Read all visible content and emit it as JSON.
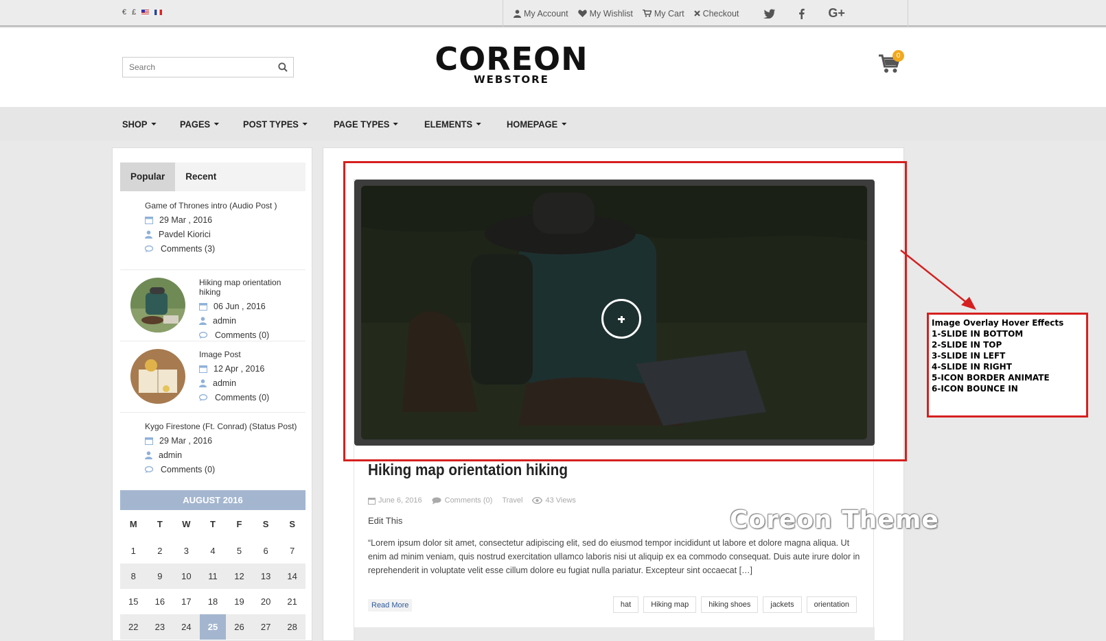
{
  "topbar": {
    "currencies": [
      "€",
      "£"
    ],
    "links": [
      {
        "label": "My Account",
        "icon": "user-icon"
      },
      {
        "label": "My Wishlist",
        "icon": "heart-icon"
      },
      {
        "label": "My Cart",
        "icon": "cart-icon"
      },
      {
        "label": "Checkout",
        "icon": "close-icon"
      }
    ],
    "social": [
      "twitter-icon",
      "facebook-icon",
      "google-plus-icon"
    ]
  },
  "header": {
    "search_placeholder": "Search",
    "logo_line1": "COREON",
    "logo_line2": "WEBSTORE",
    "cart_count": "0"
  },
  "nav": [
    "SHOP",
    "PAGES",
    "POST TYPES",
    "PAGE TYPES",
    "ELEMENTS",
    "HOMEPAGE"
  ],
  "sidebar": {
    "tabs": [
      "Popular",
      "Recent"
    ],
    "posts": [
      {
        "title": "Game of Thrones intro (Audio Post )",
        "date": "29 Mar , 2016",
        "author": "Pavdel Kiorici",
        "comments": "Comments (3)"
      },
      {
        "title": "Hiking map orientation hiking",
        "date": "06 Jun , 2016",
        "author": "admin",
        "comments": "Comments (0)"
      },
      {
        "title": "Image Post",
        "date": "12 Apr , 2016",
        "author": "admin",
        "comments": "Comments (0)"
      },
      {
        "title": "Kygo Firestone (Ft. Conrad) (Status Post)",
        "date": "29 Mar , 2016",
        "author": "admin",
        "comments": "Comments (0)"
      }
    ],
    "calendar": {
      "month": "AUGUST 2016",
      "days": [
        "M",
        "T",
        "W",
        "T",
        "F",
        "S",
        "S"
      ],
      "weeks": [
        [
          "1",
          "2",
          "3",
          "4",
          "5",
          "6",
          "7"
        ],
        [
          "8",
          "9",
          "10",
          "11",
          "12",
          "13",
          "14"
        ],
        [
          "15",
          "16",
          "17",
          "18",
          "19",
          "20",
          "21"
        ],
        [
          "22",
          "23",
          "24",
          "25",
          "26",
          "27",
          "28"
        ]
      ],
      "today": "25"
    }
  },
  "article": {
    "title": "Hiking map orientation hiking",
    "date": "June 6, 2016",
    "comments": "Comments (0)",
    "category": "Travel",
    "views": "43 Views",
    "edit": "Edit This",
    "excerpt": "“Lorem ipsum dolor sit amet, consectetur adipiscing elit, sed do eiusmod tempor incididunt ut labore et dolore magna aliqua. Ut enim ad minim veniam, quis nostrud exercitation ullamco laboris nisi ut aliquip ex ea commodo consequat. Duis aute irure dolor in reprehenderit in voluptate velit esse cillum dolore eu fugiat nulla pariatur. Excepteur sint occaecat […]",
    "read_more": "Read More",
    "tags": [
      "hat",
      "Hiking map",
      "hiking shoes",
      "jackets",
      "orientation"
    ]
  },
  "watermark": "Coreon Theme",
  "annotation": {
    "lines": [
      "Image Overlay Hover Effects",
      "1-SLIDE IN BOTTOM",
      "2-SLIDE IN TOP",
      "3-SLIDE IN LEFT",
      "4-SLIDE IN RIGHT",
      "5-ICON BORDER ANIMATE",
      "6-ICON BOUNCE IN"
    ]
  },
  "colors": {
    "accent_blue": "#a4b6cf",
    "badge_orange": "#f2a81d",
    "annotation_red": "#d61f1f",
    "link_blue": "#2d5a9a"
  }
}
